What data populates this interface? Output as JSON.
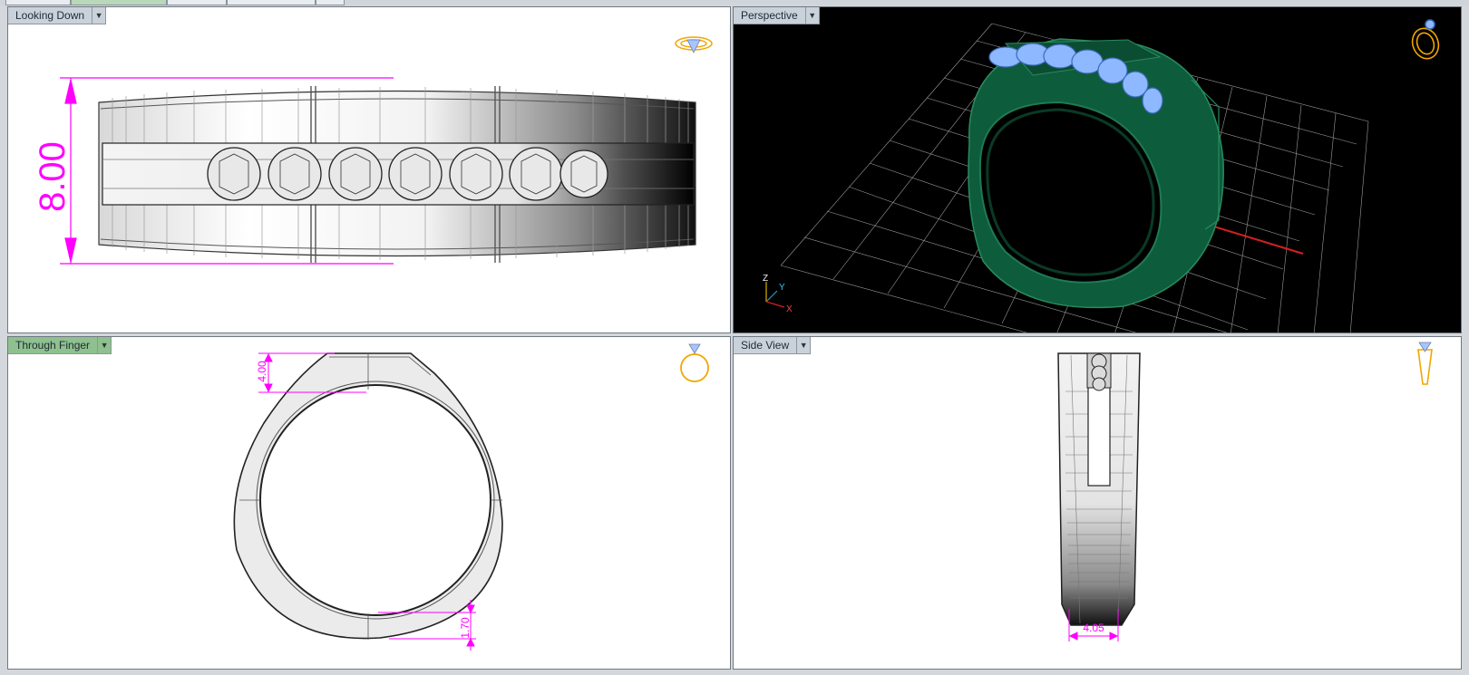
{
  "viewports": {
    "top_left": {
      "label": "Looking Down",
      "dimension": "8.00"
    },
    "top_right": {
      "label": "Perspective",
      "axes": {
        "z": "Z",
        "y": "Y",
        "x": "X"
      }
    },
    "bottom_left": {
      "label": "Through Finger",
      "dimension_top": "4.00",
      "dimension_bottom": "1.70"
    },
    "bottom_right": {
      "label": "Side View",
      "dimension": "4.05"
    }
  },
  "icons": {
    "dropdown": "chevron-down-icon",
    "ring_top": "ring-top-view-icon",
    "ring_perspective": "ring-perspective-icon",
    "ring_front": "ring-front-view-icon",
    "ring_side": "ring-side-view-icon"
  },
  "colors": {
    "dimension": "#ff00ff",
    "active_viewport": "#8fc08f",
    "ring_green": "#0d5c3c",
    "gem_blue": "#8eb8ff",
    "icon_gold": "#f2a600",
    "axis_x": "#d42020",
    "axis_y": "#20a0c0"
  }
}
